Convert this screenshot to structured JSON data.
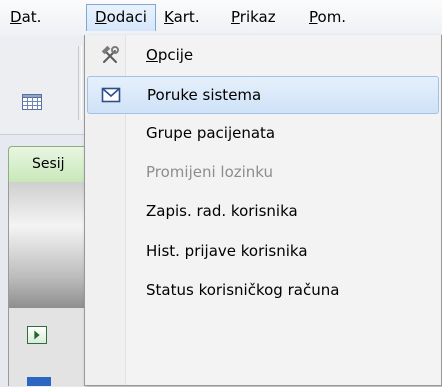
{
  "menubar": {
    "items": [
      {
        "label": "Dat.",
        "mnemonic_index": 0
      },
      {
        "label": "Dodaci",
        "mnemonic_index": 0
      },
      {
        "label": "Kart.",
        "mnemonic_index": 0
      },
      {
        "label": "Prikaz",
        "mnemonic_index": 0
      },
      {
        "label": "Pom.",
        "mnemonic_index": 0
      }
    ],
    "active": "Dodaci"
  },
  "background": {
    "tab_label": "Sesij"
  },
  "dropdown": {
    "items": [
      {
        "label": "Opcije",
        "icon": "tools-icon",
        "state": "normal"
      },
      {
        "label": "Poruke sistema",
        "icon": "envelope-icon",
        "state": "highlighted"
      },
      {
        "label": "Grupe pacijenata",
        "icon": "",
        "state": "normal"
      },
      {
        "label": "Promijeni lozinku",
        "icon": "",
        "state": "disabled"
      },
      {
        "label": "Zapis. rad. korisnika",
        "icon": "",
        "state": "normal"
      },
      {
        "label": "Hist. prijave korisnika",
        "icon": "",
        "state": "normal"
      },
      {
        "label": "Status korisničkog računa",
        "icon": "",
        "state": "normal"
      }
    ]
  },
  "colors": {
    "highlight": "#cfe2f8",
    "disabled_text": "#8d8d8d",
    "tab_green": "#c8e8b8"
  }
}
